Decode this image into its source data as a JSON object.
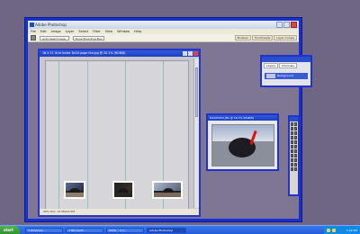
{
  "app": {
    "title": "Adobe Photoshop",
    "menu": [
      "File",
      "Edit",
      "Image",
      "Layer",
      "Select",
      "Filter",
      "View",
      "Window",
      "Help"
    ],
    "options": {
      "field1": "Auto Select Layer",
      "field2": "Show Bounding Box",
      "tabs": [
        "Brushes",
        "Tool Presets",
        "Layer Comps"
      ]
    }
  },
  "document": {
    "title": "16 X 11 Grid Under 8x10 page lite.jpg @ 20.1% (RGB/8)",
    "status": "20% Doc: 14.5M/14.5M",
    "photos": [
      "photo-1",
      "photo-2",
      "photo-3"
    ]
  },
  "navigator": {
    "tabs": [
      "Layers",
      "Channels"
    ],
    "layer_label": "Background"
  },
  "image_window": {
    "title": "DSC05432.JPG @ 16.7% (RGB/8)"
  },
  "taskbar": {
    "start": "start",
    "tasks": [
      "3 Windows...",
      "2 Microsoft...",
      "DSC0... A C...",
      "Adobe Photoshop"
    ],
    "clock": "1:22 PM"
  }
}
